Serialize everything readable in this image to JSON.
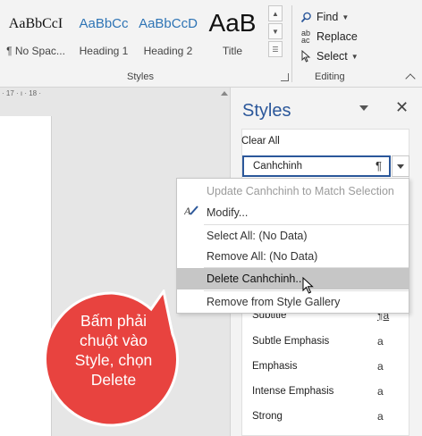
{
  "ribbon": {
    "gallery": [
      {
        "preview": "AaBbCcI",
        "name": "¶ No Spac...",
        "kind": "normal"
      },
      {
        "preview": "AaBbCc",
        "name": "Heading 1",
        "kind": "heading"
      },
      {
        "preview": "AaBbCcD",
        "name": "Heading 2",
        "kind": "heading"
      },
      {
        "preview": "AaB",
        "name": "Title",
        "kind": "title"
      }
    ],
    "styles_group_label": "Styles",
    "editing_group_label": "Editing",
    "find_label": "Find",
    "replace_label": "Replace",
    "select_label": "Select"
  },
  "ruler": {
    "text": "· 17 · ı · 18 ·"
  },
  "pane": {
    "title": "Styles",
    "clear_all": "Clear All",
    "current_style": "Canhchinh",
    "paragraph_mark": "¶",
    "styles": [
      {
        "name": "Subtitle",
        "symbol": "¶a",
        "symbol_kind": "para"
      },
      {
        "name": "Subtle Emphasis",
        "symbol": "a",
        "symbol_kind": "char"
      },
      {
        "name": "Emphasis",
        "symbol": "a",
        "symbol_kind": "char"
      },
      {
        "name": "Intense Emphasis",
        "symbol": "a",
        "symbol_kind": "char"
      },
      {
        "name": "Strong",
        "symbol": "a",
        "symbol_kind": "char"
      }
    ]
  },
  "context_menu": {
    "update": "Update Canhchinh to Match Selection",
    "modify": "Modify...",
    "select_all": "Select All: (No Data)",
    "remove_all": "Remove All: (No Data)",
    "delete": "Delete Canhchinh...",
    "remove_gallery": "Remove from Style Gallery"
  },
  "callout": {
    "lines": [
      "Bấm phải",
      "chuột vào",
      "Style, chọn",
      "Delete"
    ],
    "color": "#e8433f"
  },
  "colors": {
    "accent": "#2b579a",
    "highlight": "#c6c6c6"
  }
}
